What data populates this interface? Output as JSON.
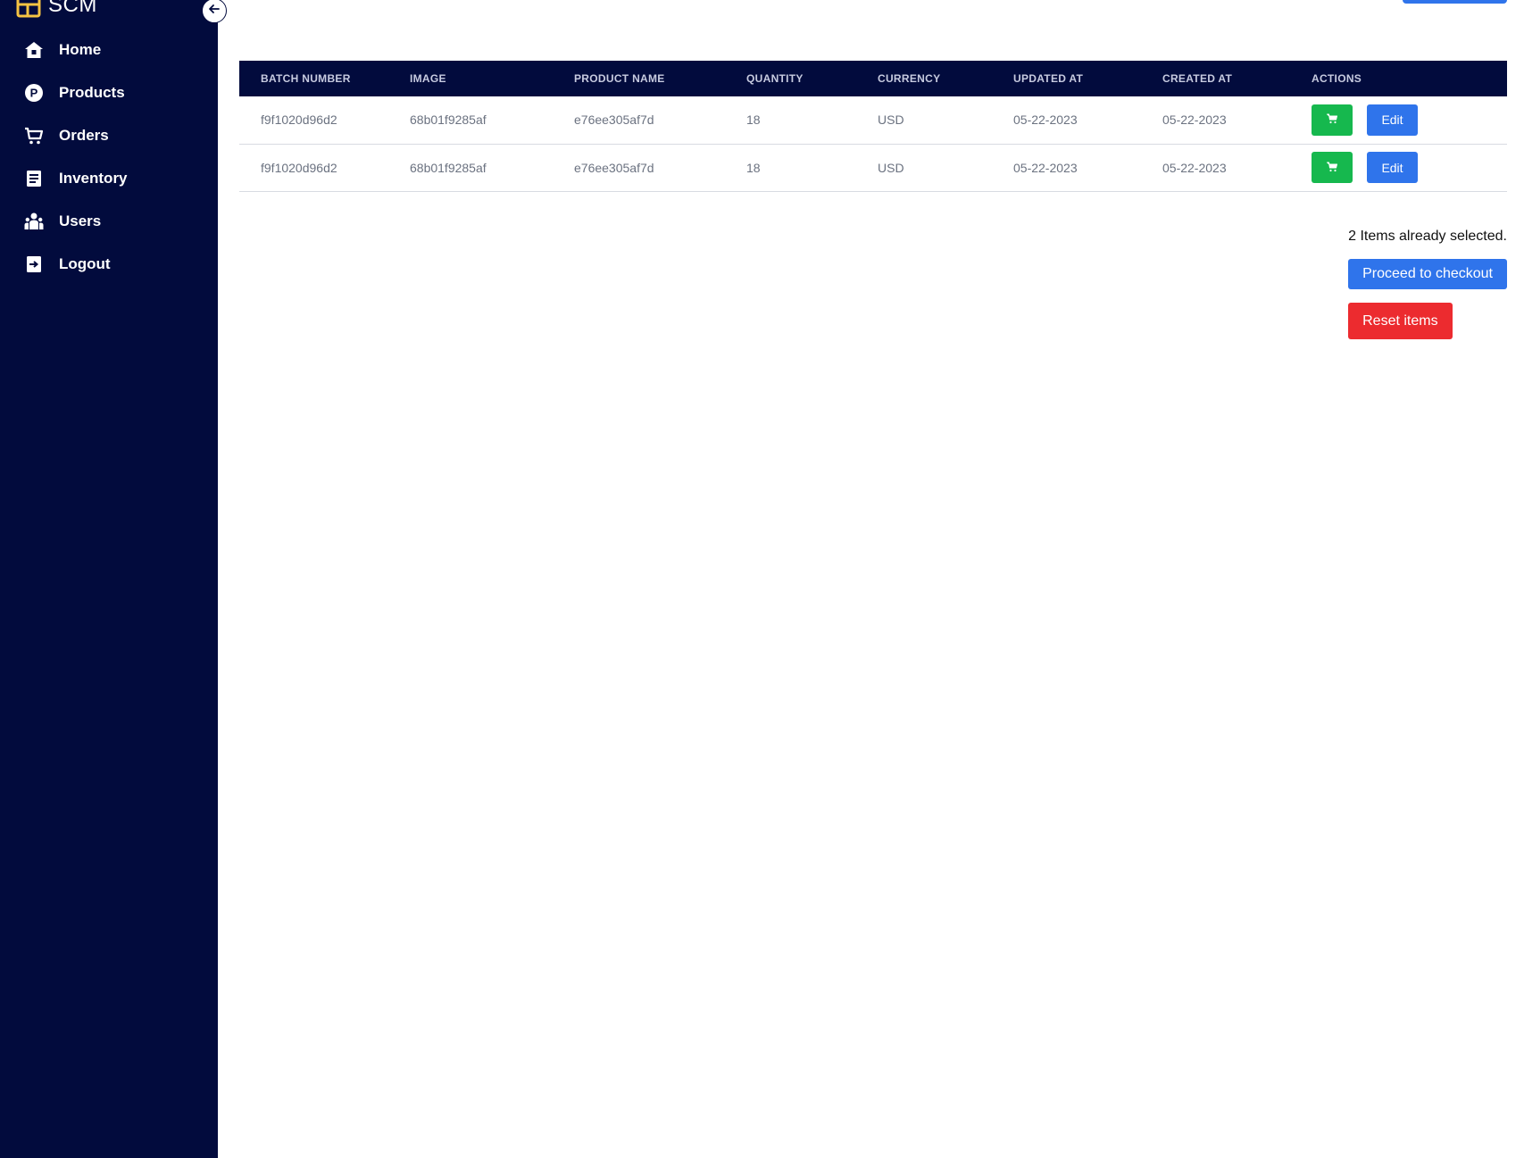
{
  "sidebar": {
    "brand": {
      "name": "SCM",
      "logo_icon": "grid-logo-icon",
      "logo_color": "#f5c343"
    },
    "collapse_icon": "arrow-left-icon",
    "items": [
      {
        "label": "Home",
        "icon": "home-icon"
      },
      {
        "label": "Products",
        "icon": "product-p-icon"
      },
      {
        "label": "Orders",
        "icon": "cart-icon"
      },
      {
        "label": "Inventory",
        "icon": "document-icon"
      },
      {
        "label": "Users",
        "icon": "users-icon"
      },
      {
        "label": "Logout",
        "icon": "logout-icon"
      }
    ]
  },
  "table": {
    "headers": [
      "BATCH NUMBER",
      "IMAGE",
      "PRODUCT NAME",
      "QUANTITY",
      "CURRENCY",
      "UPDATED AT",
      "CREATED AT",
      "ACTIONS"
    ],
    "rows": [
      {
        "batch_number": "f9f1020d96d2",
        "image": "68b01f9285af",
        "product_name": "e76ee305af7d",
        "quantity": "18",
        "currency": "USD",
        "updated_at": "05-22-2023",
        "created_at": "05-22-2023",
        "edit_label": "Edit"
      },
      {
        "batch_number": "f9f1020d96d2",
        "image": "68b01f9285af",
        "product_name": "e76ee305af7d",
        "quantity": "18",
        "currency": "USD",
        "updated_at": "05-22-2023",
        "created_at": "05-22-2023",
        "edit_label": "Edit"
      }
    ]
  },
  "summary": {
    "selected_text": "2 Items already selected.",
    "checkout_label": "Proceed to checkout",
    "reset_label": "Reset items"
  },
  "colors": {
    "sidebar_bg": "#020b3d",
    "primary": "#2f74eb",
    "success": "#16b84e",
    "danger": "#ec2b2f"
  }
}
